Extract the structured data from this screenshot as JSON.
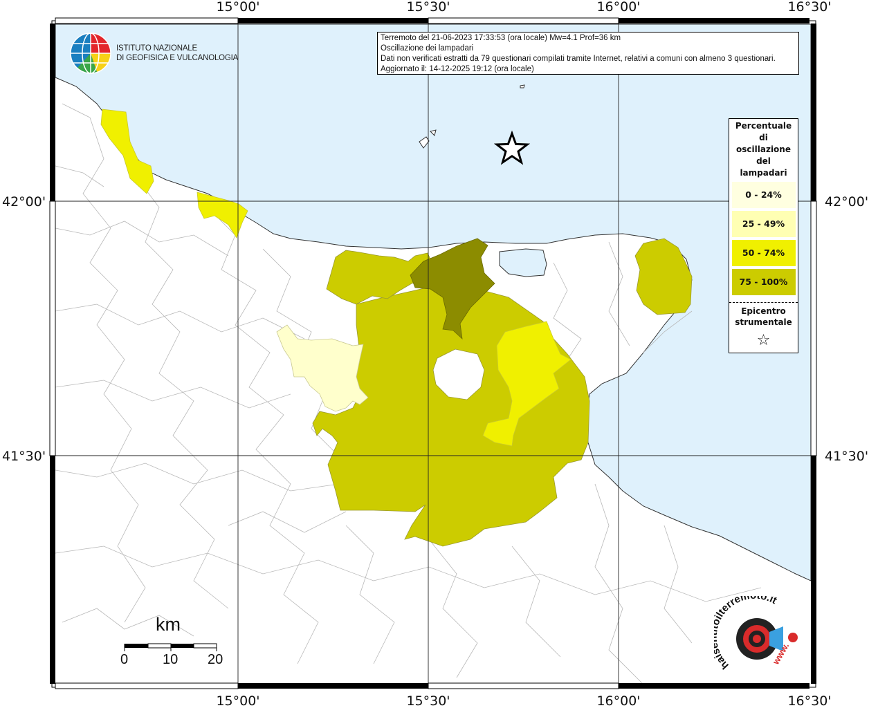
{
  "info_box": {
    "line1": "Terremoto del 21-06-2023 17:33:53 (ora locale) Mw=4.1 Prof=36 km",
    "line2": "Oscillazione dei lampadari",
    "line3": "Dati non verificati estratti da 79 questionari compilati tramite Internet, relativi a comuni con almeno 3 questionari.",
    "line4": "Aggiornato il: 14-12-2025 19:12 (ora locale)"
  },
  "institute": {
    "line1": "ISTITUTO NAZIONALE",
    "line2": "DI GEOFISICA E VULCANOLOGIA"
  },
  "longitude_ticks": [
    "15°00'",
    "15°30'",
    "16°00'",
    "16°30'"
  ],
  "latitude_ticks": [
    "42°00'",
    "41°30'"
  ],
  "legend": {
    "title_lines": [
      "Percentuale",
      "di",
      "oscillazione",
      "del",
      "lampadari"
    ],
    "classes": [
      {
        "label": "0 - 24%",
        "color": "#ffffe0"
      },
      {
        "label": "25 - 49%",
        "color": "#ffffb3"
      },
      {
        "label": "50 - 74%",
        "color": "#f0f000"
      },
      {
        "label": "75 - 100%",
        "color": "#cccc00"
      }
    ],
    "epicenter_lines": [
      "Epicentro",
      "strumentale"
    ],
    "epicenter_symbol": "☆"
  },
  "scale_bar": {
    "unit": "km",
    "labels": [
      "0",
      "10",
      "20"
    ]
  },
  "colors": {
    "sea": "#dff1fc",
    "land": "#ffffff",
    "dark_olive": "#8c8c00",
    "class_75_100": "#cccc00",
    "class_50_74": "#f0f000",
    "class_25_49": "#ffffb3",
    "class_0_24": "#ffffe0"
  },
  "watermark": {
    "text": "haisentitoilterremoto.it",
    "text2": "www."
  }
}
